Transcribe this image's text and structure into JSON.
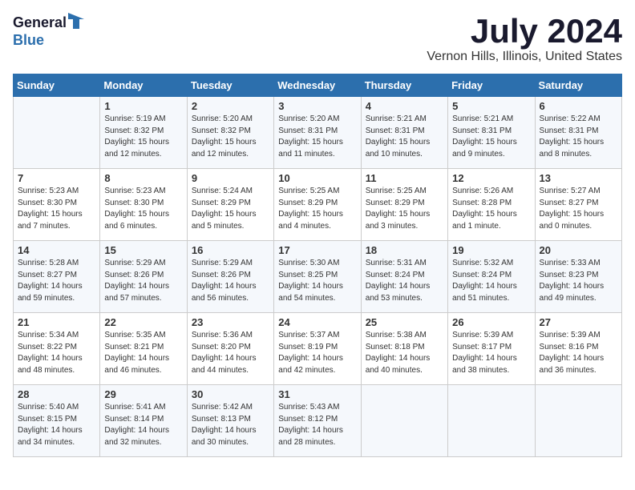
{
  "header": {
    "logo_general": "General",
    "logo_blue": "Blue",
    "month_title": "July 2024",
    "location": "Vernon Hills, Illinois, United States"
  },
  "days_of_week": [
    "Sunday",
    "Monday",
    "Tuesday",
    "Wednesday",
    "Thursday",
    "Friday",
    "Saturday"
  ],
  "weeks": [
    [
      {
        "day": "",
        "info": ""
      },
      {
        "day": "1",
        "info": "Sunrise: 5:19 AM\nSunset: 8:32 PM\nDaylight: 15 hours\nand 12 minutes."
      },
      {
        "day": "2",
        "info": "Sunrise: 5:20 AM\nSunset: 8:32 PM\nDaylight: 15 hours\nand 12 minutes."
      },
      {
        "day": "3",
        "info": "Sunrise: 5:20 AM\nSunset: 8:31 PM\nDaylight: 15 hours\nand 11 minutes."
      },
      {
        "day": "4",
        "info": "Sunrise: 5:21 AM\nSunset: 8:31 PM\nDaylight: 15 hours\nand 10 minutes."
      },
      {
        "day": "5",
        "info": "Sunrise: 5:21 AM\nSunset: 8:31 PM\nDaylight: 15 hours\nand 9 minutes."
      },
      {
        "day": "6",
        "info": "Sunrise: 5:22 AM\nSunset: 8:31 PM\nDaylight: 15 hours\nand 8 minutes."
      }
    ],
    [
      {
        "day": "7",
        "info": "Sunrise: 5:23 AM\nSunset: 8:30 PM\nDaylight: 15 hours\nand 7 minutes."
      },
      {
        "day": "8",
        "info": "Sunrise: 5:23 AM\nSunset: 8:30 PM\nDaylight: 15 hours\nand 6 minutes."
      },
      {
        "day": "9",
        "info": "Sunrise: 5:24 AM\nSunset: 8:29 PM\nDaylight: 15 hours\nand 5 minutes."
      },
      {
        "day": "10",
        "info": "Sunrise: 5:25 AM\nSunset: 8:29 PM\nDaylight: 15 hours\nand 4 minutes."
      },
      {
        "day": "11",
        "info": "Sunrise: 5:25 AM\nSunset: 8:29 PM\nDaylight: 15 hours\nand 3 minutes."
      },
      {
        "day": "12",
        "info": "Sunrise: 5:26 AM\nSunset: 8:28 PM\nDaylight: 15 hours\nand 1 minute."
      },
      {
        "day": "13",
        "info": "Sunrise: 5:27 AM\nSunset: 8:27 PM\nDaylight: 15 hours\nand 0 minutes."
      }
    ],
    [
      {
        "day": "14",
        "info": "Sunrise: 5:28 AM\nSunset: 8:27 PM\nDaylight: 14 hours\nand 59 minutes."
      },
      {
        "day": "15",
        "info": "Sunrise: 5:29 AM\nSunset: 8:26 PM\nDaylight: 14 hours\nand 57 minutes."
      },
      {
        "day": "16",
        "info": "Sunrise: 5:29 AM\nSunset: 8:26 PM\nDaylight: 14 hours\nand 56 minutes."
      },
      {
        "day": "17",
        "info": "Sunrise: 5:30 AM\nSunset: 8:25 PM\nDaylight: 14 hours\nand 54 minutes."
      },
      {
        "day": "18",
        "info": "Sunrise: 5:31 AM\nSunset: 8:24 PM\nDaylight: 14 hours\nand 53 minutes."
      },
      {
        "day": "19",
        "info": "Sunrise: 5:32 AM\nSunset: 8:24 PM\nDaylight: 14 hours\nand 51 minutes."
      },
      {
        "day": "20",
        "info": "Sunrise: 5:33 AM\nSunset: 8:23 PM\nDaylight: 14 hours\nand 49 minutes."
      }
    ],
    [
      {
        "day": "21",
        "info": "Sunrise: 5:34 AM\nSunset: 8:22 PM\nDaylight: 14 hours\nand 48 minutes."
      },
      {
        "day": "22",
        "info": "Sunrise: 5:35 AM\nSunset: 8:21 PM\nDaylight: 14 hours\nand 46 minutes."
      },
      {
        "day": "23",
        "info": "Sunrise: 5:36 AM\nSunset: 8:20 PM\nDaylight: 14 hours\nand 44 minutes."
      },
      {
        "day": "24",
        "info": "Sunrise: 5:37 AM\nSunset: 8:19 PM\nDaylight: 14 hours\nand 42 minutes."
      },
      {
        "day": "25",
        "info": "Sunrise: 5:38 AM\nSunset: 8:18 PM\nDaylight: 14 hours\nand 40 minutes."
      },
      {
        "day": "26",
        "info": "Sunrise: 5:39 AM\nSunset: 8:17 PM\nDaylight: 14 hours\nand 38 minutes."
      },
      {
        "day": "27",
        "info": "Sunrise: 5:39 AM\nSunset: 8:16 PM\nDaylight: 14 hours\nand 36 minutes."
      }
    ],
    [
      {
        "day": "28",
        "info": "Sunrise: 5:40 AM\nSunset: 8:15 PM\nDaylight: 14 hours\nand 34 minutes."
      },
      {
        "day": "29",
        "info": "Sunrise: 5:41 AM\nSunset: 8:14 PM\nDaylight: 14 hours\nand 32 minutes."
      },
      {
        "day": "30",
        "info": "Sunrise: 5:42 AM\nSunset: 8:13 PM\nDaylight: 14 hours\nand 30 minutes."
      },
      {
        "day": "31",
        "info": "Sunrise: 5:43 AM\nSunset: 8:12 PM\nDaylight: 14 hours\nand 28 minutes."
      },
      {
        "day": "",
        "info": ""
      },
      {
        "day": "",
        "info": ""
      },
      {
        "day": "",
        "info": ""
      }
    ]
  ]
}
